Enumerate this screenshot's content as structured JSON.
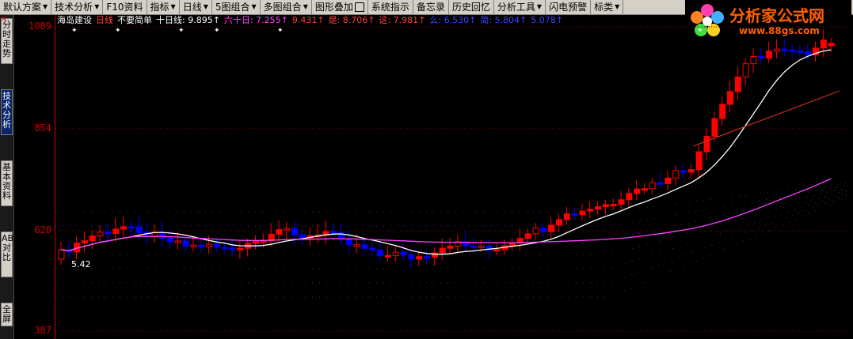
{
  "toolbar": {
    "items": [
      "默认方案",
      "技术分析",
      "F10资料",
      "指标",
      "日线",
      "5图组合",
      "多图组合",
      "图形叠加",
      "系统指示",
      "备忘录",
      "历史回忆",
      "分析工具",
      "闪电预警",
      "标类"
    ]
  },
  "sidebar": {
    "tabs": [
      "分时走势",
      "技术分析",
      "基本资料",
      "ABH对比",
      "全屏"
    ]
  },
  "axis": {
    "labels": [
      "1089",
      "854",
      "620",
      "387"
    ]
  },
  "ticker": {
    "name": "海岛建设",
    "period": "日线",
    "formula": "不要简单",
    "fields": [
      {
        "label": "十日线:",
        "value": "9.895",
        "color": "#ffffff"
      },
      {
        "label": "六十日:",
        "value": "7.255",
        "color": "#ff40ff"
      },
      {
        "label": "",
        "value": "9.431",
        "color": "#ff4040"
      },
      {
        "label": "是:",
        "value": "8.706",
        "color": "#ff4040"
      },
      {
        "label": "这:",
        "value": "7.981",
        "color": "#ff4040"
      },
      {
        "label": "么:",
        "value": "6.530",
        "color": "#4040ff"
      },
      {
        "label": "简:",
        "value": "5.804",
        "color": "#4040ff"
      },
      {
        "label": "",
        "value": "5.078",
        "color": "#4040ff"
      }
    ]
  },
  "chart_annotation": "5.42",
  "logo": {
    "title": "分析家公式网",
    "url": "www.88gs.com"
  },
  "colors": {
    "up": "#ff0000",
    "down": "#0000ff",
    "ma10": "#ffffff",
    "ma60": "#ff40ff",
    "trend": "#c03020"
  }
}
